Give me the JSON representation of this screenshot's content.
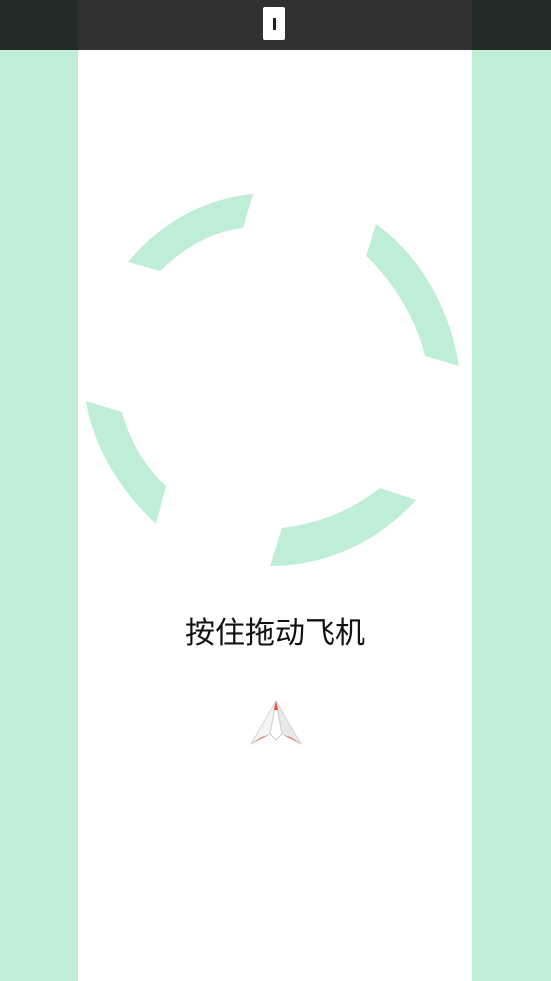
{
  "hud": {
    "pause_icon": "pause-icon"
  },
  "game": {
    "instruction": "按住拖动飞机",
    "player_icon": "paper-plane-icon",
    "target_ring_segments": 4
  },
  "colors": {
    "side_band": "#bfeed6",
    "ring": "#bfeed6",
    "background": "#ffffff",
    "top_bar": "#1e1e1e",
    "plane_accent": "#e8503a"
  }
}
